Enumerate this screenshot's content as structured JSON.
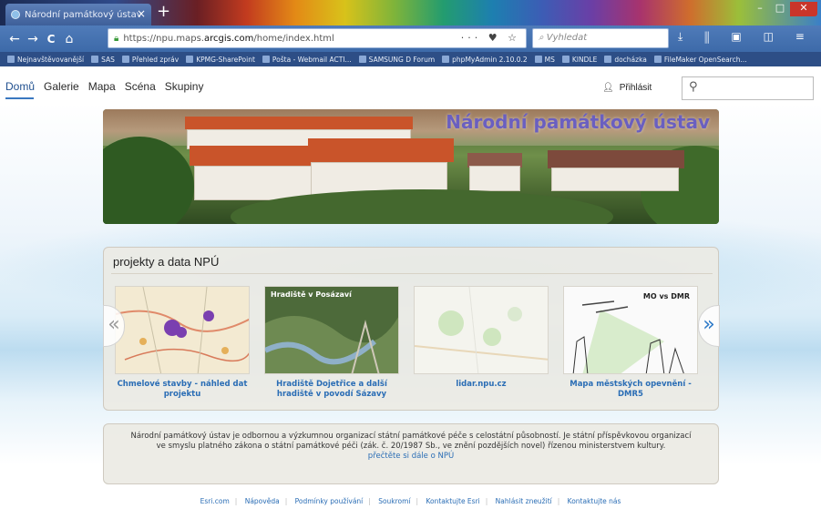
{
  "browser": {
    "tab_title": "Národní památkový ústav",
    "tab_close": "×",
    "new_tab": "+",
    "window_buttons": [
      "–",
      "□",
      "✕"
    ],
    "nav_buttons": [
      "←",
      "→",
      "C",
      "⌂"
    ],
    "url_prefix": "https://npu.maps.",
    "url_host": "arcgis.com",
    "url_path": "/home/index.html",
    "url_tools": "··· ♥ ☆",
    "search_placeholder": "Vyhledat",
    "toolbar_icons": "⤓ ⫼ ▣ ◫ ≡",
    "bookmarks": [
      "Nejnavštěvovanější",
      "SAS",
      "Přehled zpráv",
      "KPMG-SharePoint",
      "Pošta - Webmail ACTI...",
      "SAMSUNG D Forum",
      "phpMyAdmin 2.10.0.2",
      "MS",
      "KINDLE",
      "docházka",
      "FileMaker OpenSearch..."
    ]
  },
  "site": {
    "nav": [
      "Domů",
      "Galerie",
      "Mapa",
      "Scéna",
      "Skupiny"
    ],
    "login_label": "Přihlásit",
    "search_icon": "search-icon",
    "banner_title": "Národní památkový ústav",
    "gallery": {
      "title": "projekty a data NPÚ",
      "cards": [
        {
          "label": "Chmelové stavby - náhled dat projektu",
          "thumb_caption": ""
        },
        {
          "label": "Hradiště Dojetřice a další hradiště v povodí Sázavy",
          "thumb_caption": "Hradiště v Posázaví"
        },
        {
          "label": "lidar.npu.cz",
          "thumb_caption": ""
        },
        {
          "label": "Mapa městských opevnění - DMR5",
          "thumb_caption": "MO vs DMR"
        }
      ],
      "arrow_prev": "«",
      "arrow_next": "»"
    },
    "about": {
      "text": "Národní památkový ústav je odbornou a výzkumnou organizací státní památkové péče s celostátní působností. Je státní příspěvkovou organizací ve smyslu platného zákona o státní památkové péči (zák. č. 20/1987 Sb., ve znění pozdějších novel) řízenou ministerstvem kultury.",
      "link": "přečtěte si dále o NPÚ"
    },
    "footer": [
      "Esri.com",
      "Nápověda",
      "Podmínky používání",
      "Soukromí",
      "Kontaktujte Esri",
      "Nahlásit zneužití",
      "Kontaktujte nás"
    ]
  },
  "colors": {
    "accent": "#3a78c0",
    "link": "#2a6db5",
    "banner_title": "#6a5fc0"
  }
}
